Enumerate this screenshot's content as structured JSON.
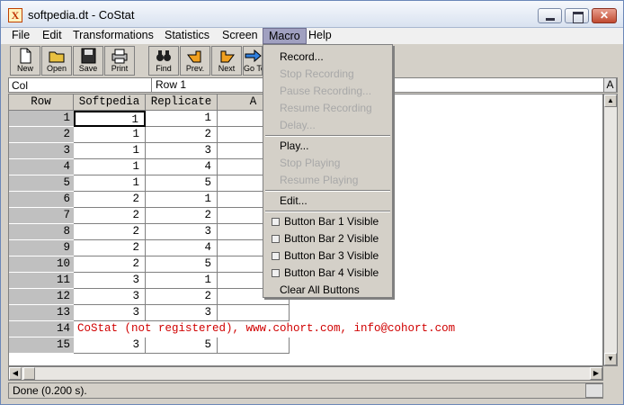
{
  "window": {
    "title": "softpedia.dt - CoStat",
    "app_icon": "X"
  },
  "menubar": {
    "items": [
      "File",
      "Edit",
      "Transformations",
      "Statistics",
      "Screen",
      "Macro",
      "Help"
    ]
  },
  "toolbar": {
    "buttons": [
      {
        "label": "New",
        "icon": "new-document-icon"
      },
      {
        "label": "Open",
        "icon": "open-folder-icon"
      },
      {
        "label": "Save",
        "icon": "save-disk-icon"
      },
      {
        "label": "Print",
        "icon": "printer-icon"
      },
      {
        "label": "Find",
        "icon": "binoculars-icon"
      },
      {
        "label": "Prev.",
        "icon": "hand-left-icon"
      },
      {
        "label": "Next",
        "icon": "hand-right-icon"
      },
      {
        "label": "Go To",
        "icon": "arrow-right-icon"
      }
    ]
  },
  "cellbar": {
    "col_label": "Col",
    "row_label": "Row 1",
    "button": "A"
  },
  "grid": {
    "headers": [
      "Row",
      "Softpedia",
      "Replicate",
      "A"
    ],
    "rows": [
      {
        "n": "1",
        "a": "1",
        "b": "1"
      },
      {
        "n": "2",
        "a": "1",
        "b": "2"
      },
      {
        "n": "3",
        "a": "1",
        "b": "3"
      },
      {
        "n": "4",
        "a": "1",
        "b": "4"
      },
      {
        "n": "5",
        "a": "1",
        "b": "5"
      },
      {
        "n": "6",
        "a": "2",
        "b": "1"
      },
      {
        "n": "7",
        "a": "2",
        "b": "2"
      },
      {
        "n": "8",
        "a": "2",
        "b": "3"
      },
      {
        "n": "9",
        "a": "2",
        "b": "4"
      },
      {
        "n": "10",
        "a": "2",
        "b": "5"
      },
      {
        "n": "11",
        "a": "3",
        "b": "1"
      },
      {
        "n": "12",
        "a": "3",
        "b": "2"
      },
      {
        "n": "13",
        "a": "3",
        "b": "3"
      },
      {
        "n": "14",
        "a": "",
        "b": ""
      },
      {
        "n": "15",
        "a": "3",
        "b": "5"
      }
    ],
    "registration_text": "CoStat (not registered), www.cohort.com, info@cohort.com",
    "registration_color": "#d00000"
  },
  "macro_menu": {
    "record": "Record...",
    "stop_recording": "Stop Recording",
    "pause_recording": "Pause Recording...",
    "resume_recording": "Resume Recording",
    "delay": "Delay...",
    "play": "Play...",
    "stop_playing": "Stop Playing",
    "resume_playing": "Resume Playing",
    "edit": "Edit...",
    "bar1": "Button Bar 1 Visible",
    "bar2": "Button Bar 2 Visible",
    "bar3": "Button Bar 3 Visible",
    "bar4": "Button Bar 4 Visible",
    "clear": "Clear All Buttons"
  },
  "status": {
    "text": "Done (0.200 s)."
  }
}
